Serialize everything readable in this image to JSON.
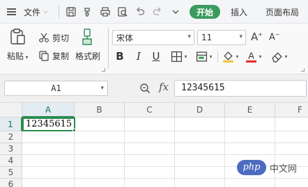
{
  "menubar": {
    "file_label": "文件",
    "tabs": [
      "开始",
      "插入",
      "页面布局"
    ],
    "quick_icons": [
      "save-icon",
      "format-painter-icon",
      "print-icon",
      "print-preview-icon",
      "undo-icon",
      "redo-icon",
      "customize-chevron-icon"
    ]
  },
  "ribbon": {
    "paste_label": "粘贴",
    "cut_label": "剪切",
    "copy_label": "复制",
    "format_painter_label": "格式刷",
    "font_name": "宋体",
    "font_size": "11",
    "bold": "B",
    "italic": "I",
    "underline": "U",
    "font_color": "#e0322f",
    "fill_color": "#f6c443"
  },
  "formula_bar": {
    "name_box": "A1",
    "fx": "fx",
    "value": "12345615"
  },
  "grid": {
    "columns": [
      "A",
      "B",
      "C",
      "D",
      "E",
      "F"
    ],
    "rows": [
      "1",
      "2",
      "3",
      "4",
      "5",
      "6"
    ],
    "cells": {
      "A1": "12345615"
    }
  },
  "watermark": {
    "logo": "php",
    "text": "中文网"
  },
  "colors": {
    "accent": "#3a9b5d",
    "selection": "#2b8c4f"
  }
}
